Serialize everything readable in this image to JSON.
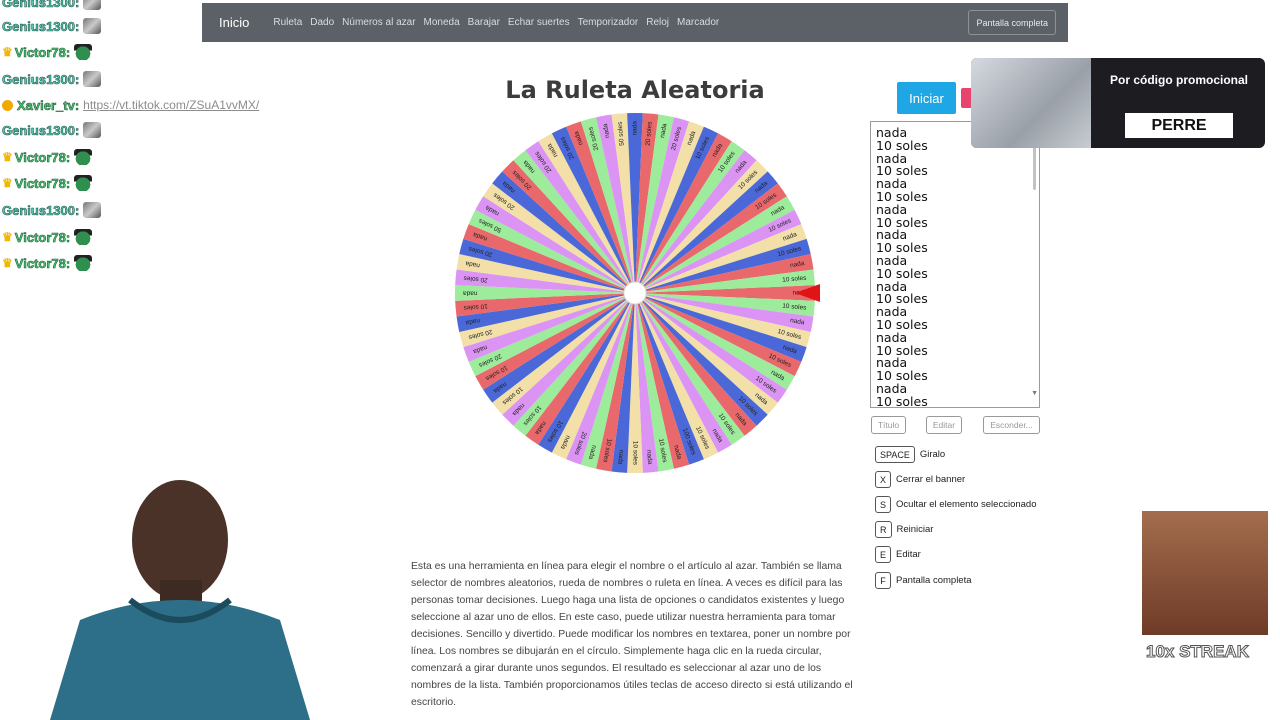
{
  "navbar": {
    "brand": "Inicio",
    "links": [
      "Ruleta",
      "Dado",
      "Números al azar",
      "Moneda",
      "Barajar",
      "Echar suertes",
      "Temporizador",
      "Reloj",
      "Marcador"
    ],
    "fullscreen": "Pantalla completa"
  },
  "page": {
    "title": "La Ruleta Aleatoria",
    "start_button": "Iniciar"
  },
  "entries": [
    "nada",
    "10 soles",
    "nada",
    "10 soles",
    "nada",
    "10 soles",
    "nada",
    "10 soles",
    "nada",
    "10 soles",
    "nada",
    "10 soles",
    "nada",
    "10 soles",
    "nada",
    "10 soles",
    "nada",
    "10 soles",
    "nada",
    "10 soles",
    "nada",
    "10 soles"
  ],
  "wheel": {
    "labels": [
      "nada",
      "10 soles",
      "nada",
      "10 soles",
      "nada",
      "10 soles",
      "nada",
      "10 soles",
      "nada",
      "10 soles",
      "nada",
      "10 soles",
      "nada",
      "10 soles",
      "100 soles",
      "nada",
      "10 soles",
      "nada",
      "10 soles",
      "nada",
      "10 soles",
      "nada",
      "20 soles",
      "nada",
      "10 soles",
      "nada",
      "10 soles",
      "nada",
      "10 soles",
      "nada",
      "10 soles",
      "20 soles",
      "nada",
      "20 soles",
      "nada",
      "10 soles",
      "nada",
      "20 soles",
      "nada",
      "20 soles",
      "nada",
      "50 soles",
      "nada",
      "20 soles",
      "nada",
      "20 soles",
      "nada",
      "20 soles",
      "nada",
      "20 soles",
      "nada",
      "20 soles",
      "nada",
      "50 soles",
      "nada",
      "20 soles",
      "nada",
      "20 soles",
      "nada",
      "10 soles",
      "nada",
      "10 soles",
      "nada",
      "10 soles",
      "nada",
      "10 soles",
      "nada",
      "10 soles",
      "nada",
      "10 soles",
      "nada",
      "10 soles"
    ],
    "colors": [
      "#e8686b",
      "#9cec9c",
      "#dc94f4",
      "#f2e0a8",
      "#4a68d8"
    ],
    "pointer_color": "#e01414"
  },
  "buttons": {
    "title": "Título",
    "edit": "Editar",
    "hide": "Esconder..."
  },
  "shortcuts": [
    {
      "key": "SPACE",
      "label": "Giralo"
    },
    {
      "key": "X",
      "label": "Cerrar el banner"
    },
    {
      "key": "S",
      "label": "Ocultar el elemento seleccionado"
    },
    {
      "key": "R",
      "label": "Reiniciar"
    },
    {
      "key": "E",
      "label": "Editar"
    },
    {
      "key": "F",
      "label": "Pantalla completa"
    }
  ],
  "description": "Esta es una herramienta en línea para elegir el nombre o el artículo al azar. También se llama selector de nombres aleatorios, rueda de nombres o ruleta en línea. A veces es difícil para las personas tomar decisiones. Luego haga una lista de opciones o candidatos existentes y luego seleccione al azar uno de ellos. En este caso, puede utilizar nuestra herramienta para tomar decisiones. Sencillo y divertido. Puede modificar los nombres en textarea, poner un nombre por línea. Los nombres se dibujarán en el círculo. Simplemente haga clic en la rueda circular, comenzará a girar durante unos segundos. El resultado es seleccionar al azar uno de los nombres de la lista. También proporcionamos útiles teclas de acceso directo si está utilizando el escritorio.",
  "chat": [
    {
      "user": "Genius1300",
      "style": "teal",
      "crown": false,
      "emote": "bird"
    },
    {
      "user": "Genius1300",
      "style": "teal",
      "crown": false,
      "emote": "bird"
    },
    {
      "user": "Victor78",
      "style": "green",
      "crown": true,
      "emote": "frog"
    },
    {
      "user": "Genius1300",
      "style": "teal",
      "crown": false,
      "emote": "bird"
    },
    {
      "user": "Xavier_tv",
      "style": "green",
      "crown": false,
      "emote": "",
      "link": "https://vt.tiktok.com/ZSuA1vvMX/"
    },
    {
      "user": "Genius1300",
      "style": "teal",
      "crown": false,
      "emote": "bird"
    },
    {
      "user": "Victor78",
      "style": "green",
      "crown": true,
      "emote": "frog"
    },
    {
      "user": "Victor78",
      "style": "green",
      "crown": true,
      "emote": "frog"
    },
    {
      "user": "Genius1300",
      "style": "teal",
      "crown": false,
      "emote": "bird"
    },
    {
      "user": "Victor78",
      "style": "green",
      "crown": true,
      "emote": "frog"
    },
    {
      "user": "Victor78",
      "style": "green",
      "crown": true,
      "emote": "frog"
    }
  ],
  "promo": {
    "text": "Por código promocional",
    "code": "PERRE"
  },
  "overlay": {
    "streak": "10x STREAK"
  }
}
